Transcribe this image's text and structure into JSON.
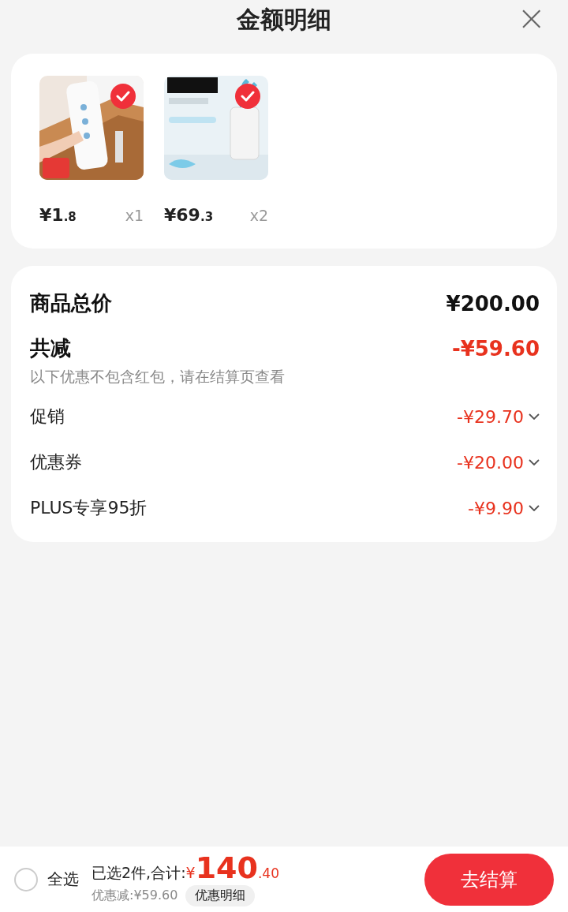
{
  "header": {
    "title": "金额明细",
    "close": "×"
  },
  "products": [
    {
      "selected": true,
      "kind": "picture",
      "price_integer": "¥1",
      "price_decimal": ".8",
      "quantity": "x1"
    },
    {
      "selected": true,
      "kind": "picture",
      "price_integer": "¥69",
      "price_decimal": ".3",
      "quantity": "x2"
    }
  ],
  "summary": {
    "total_label": "商品总价",
    "total_value": "¥200.00",
    "reduce_label": "共减",
    "reduce_value": "-¥59.60",
    "note": "以下优惠不包含红包，请在结算页查看",
    "discounts": [
      {
        "label": "促销",
        "value": "-¥29.70",
        "expanded": false
      },
      {
        "label": "优惠券",
        "value": "-¥20.00",
        "expanded": false
      },
      {
        "label": "PLUS专享95折",
        "value": "-¥9.90",
        "expanded": false
      }
    ]
  },
  "bottom_bar": {
    "select_all": {
      "label": "全选",
      "checked": false
    },
    "selected_label": "已选2件,合计:",
    "currency": "¥",
    "amount_integer": "140",
    "amount_decimal": ".40",
    "discount_text": "优惠减:¥59.60",
    "detail_button": "优惠明细",
    "checkout_button": "去结算"
  }
}
